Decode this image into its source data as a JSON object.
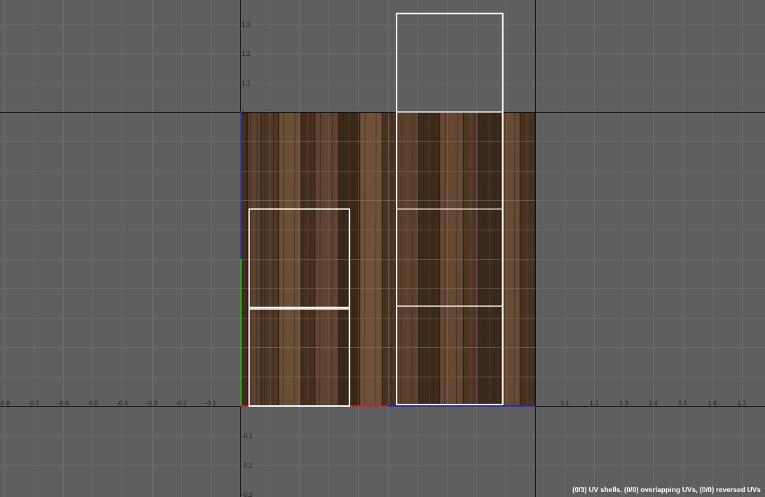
{
  "viewport": {
    "background_color": "#5f5f5f",
    "grid_color": "#6e6e6e",
    "axis_color": "#111111",
    "u_range": [
      -0.82,
      1.78
    ],
    "v_range": [
      -0.3,
      1.38
    ],
    "grid_step": 0.1
  },
  "u_tick_labels": [
    "-0.8",
    "-0.7",
    "-0.6",
    "-0.5",
    "-0.4",
    "-0.3",
    "-0.2",
    "-0.1",
    "1",
    "1.1",
    "1.2",
    "1.3",
    "1.4",
    "1.5",
    "1.6",
    "1.7"
  ],
  "v_tick_labels": [
    "1.3",
    "1.2",
    "1.1",
    "1",
    "-0.1",
    "-0.2",
    "-0.3"
  ],
  "texture": {
    "name": "wood-planks",
    "u_range": [
      0,
      1
    ],
    "v_range": [
      0,
      1
    ],
    "base_color": "#4b3523",
    "plank_color_light": "#6a4e36",
    "plank_color_dark": "#2e2015"
  },
  "uv_shells": [
    {
      "name": "uv-shell-left-top",
      "u": [
        0.03,
        0.37
      ],
      "v": [
        0.335,
        0.67
      ]
    },
    {
      "name": "uv-shell-left-bottom",
      "u": [
        0.03,
        0.37
      ],
      "v": [
        0.0,
        0.33
      ]
    },
    {
      "name": "uv-shell-right",
      "u": [
        0.53,
        0.89
      ],
      "v": [
        0.005,
        1.335
      ],
      "edges_v": [
        1.0,
        0.67,
        0.34
      ]
    }
  ],
  "edge_highlights": {
    "u_axis_red_color": "#cc2222",
    "u_axis_blue_color": "#2a2aaa",
    "v_axis_green_color": "#22aa22",
    "v_axis_blue_color": "#3333aa"
  },
  "shell_stroke_color": "#ffffff",
  "status": {
    "text": "(0/3) UV shells, (0/0) overlapping UVs, (0/0) reversed UVs"
  }
}
